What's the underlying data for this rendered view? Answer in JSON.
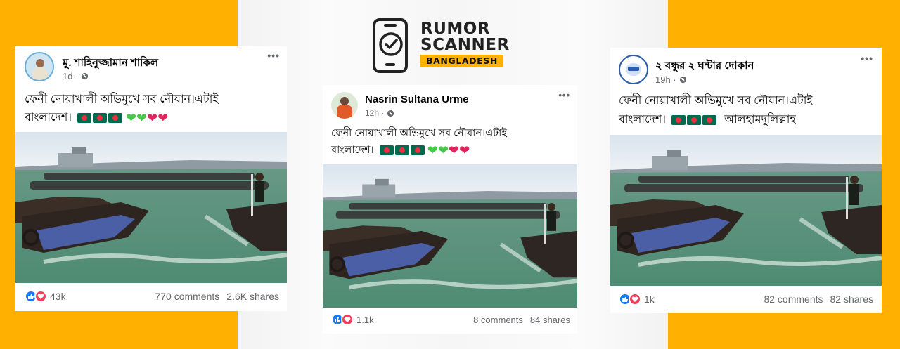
{
  "colors": {
    "brand_yellow": "#FFB000",
    "fb_blue": "#1877f2",
    "love_red": "#f33e58"
  },
  "logo": {
    "line1": "RUMOR",
    "line2": "SCANNER",
    "line3": "BANGLADESH",
    "icon": "phone-check-icon"
  },
  "posts": [
    {
      "author": "মু. শাহিনুজ্জামান শাকিল",
      "time": "1d ·",
      "text_line1": "ফেনী নোয়াখালী অভিমুখে সব নৌযান।এটাই",
      "text_line2": "বাংলাদেশ।",
      "emoji_trail": "flags-3 green-hearts-2 red-hearts-2",
      "reactions": "43k",
      "comments": "770 comments",
      "shares": "2.6K shares",
      "more": "•••"
    },
    {
      "author": "Nasrin Sultana Urme",
      "time": "12h ·",
      "text_line1": "ফেনী নোয়াখালী অভিমুখে সব নৌযান।এটাই",
      "text_line2": "বাংলাদেশ।",
      "emoji_trail": "flags-3 green-hearts-2 red-hearts-2",
      "reactions": "1.1k",
      "comments": "8 comments",
      "shares": "84 shares",
      "more": "•••"
    },
    {
      "author": "২ বন্ধুর ২ ঘন্টার দোকান",
      "time": "19h ·",
      "text_line1": "ফেনী নোয়াখালী অভিমুখে সব নৌযান।এটাই",
      "text_line2": "বাংলাদেশ।",
      "text_line2_tail": "আলহামদুলিল্লাহ",
      "emoji_trail": "flags-3",
      "reactions": "1k",
      "comments": "82 comments",
      "shares": "82 shares",
      "more": "•••"
    }
  ]
}
